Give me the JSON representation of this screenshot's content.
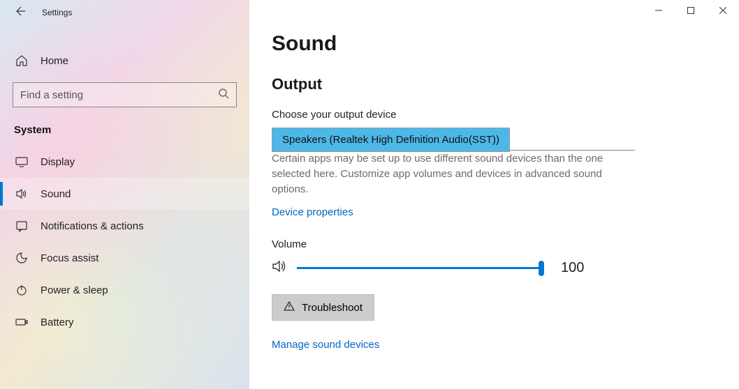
{
  "header": {
    "title": "Settings"
  },
  "sidebar": {
    "home_label": "Home",
    "search_placeholder": "Find a setting",
    "group_title": "System",
    "items": [
      {
        "label": "Display"
      },
      {
        "label": "Sound"
      },
      {
        "label": "Notifications & actions"
      },
      {
        "label": "Focus assist"
      },
      {
        "label": "Power & sleep"
      },
      {
        "label": "Battery"
      }
    ]
  },
  "main": {
    "page_title": "Sound",
    "output": {
      "section_title": "Output",
      "choose_label": "Choose your output device",
      "selected_device": "Speakers (Realtek High Definition Audio(SST))",
      "help_text": "Certain apps may be set up to use different sound devices than the one selected here. Customize app volumes and devices in advanced sound options.",
      "device_properties_link": "Device properties",
      "volume_label": "Volume",
      "volume_value": "100",
      "troubleshoot_label": "Troubleshoot",
      "manage_link": "Manage sound devices"
    }
  }
}
